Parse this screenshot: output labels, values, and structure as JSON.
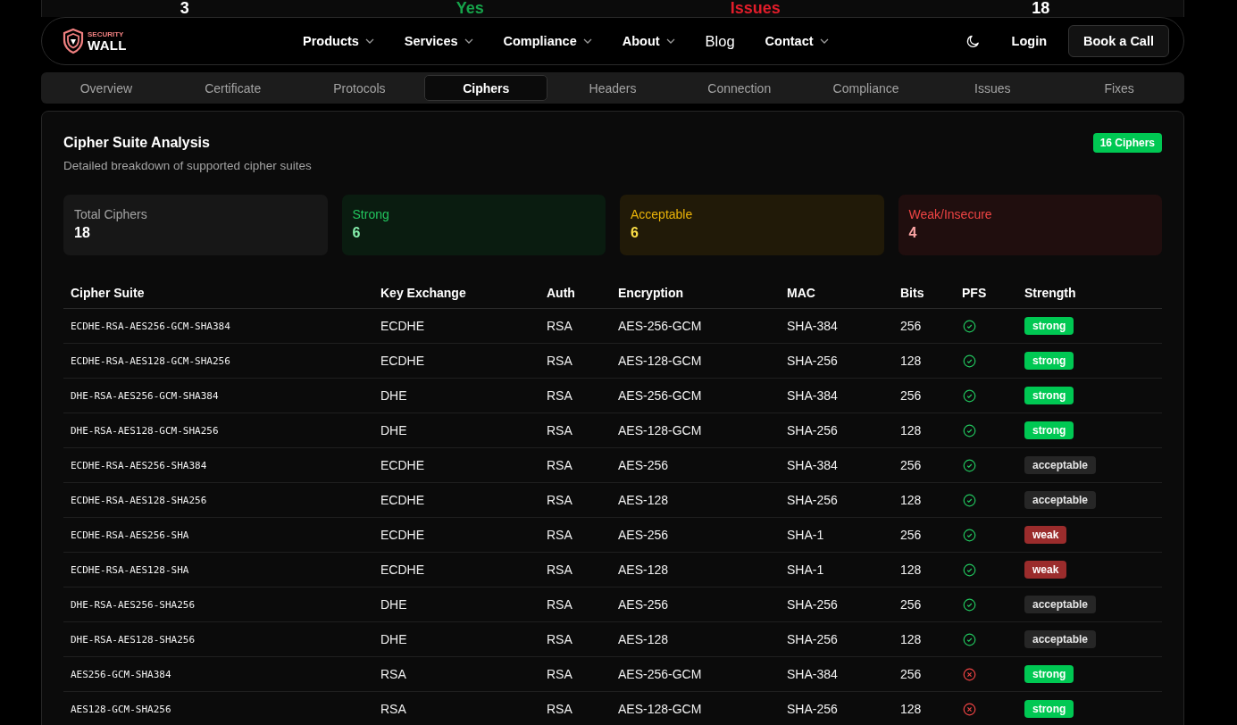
{
  "summary_strip": [
    "3",
    "Yes",
    "Issues",
    "18"
  ],
  "nav": {
    "logo_top": "SECURITY",
    "logo_bottom": "WALL",
    "links": [
      {
        "label": "Products",
        "dropdown": true
      },
      {
        "label": "Services",
        "dropdown": true
      },
      {
        "label": "Compliance",
        "dropdown": true
      },
      {
        "label": "About",
        "dropdown": true
      },
      {
        "label": "Blog",
        "dropdown": false
      },
      {
        "label": "Contact",
        "dropdown": true
      }
    ],
    "login": "Login",
    "cta": "Book a Call"
  },
  "tabs": [
    {
      "label": "Overview",
      "selected": false
    },
    {
      "label": "Certificate",
      "selected": false
    },
    {
      "label": "Protocols",
      "selected": false
    },
    {
      "label": "Ciphers",
      "selected": true
    },
    {
      "label": "Headers",
      "selected": false
    },
    {
      "label": "Connection",
      "selected": false
    },
    {
      "label": "Compliance",
      "selected": false
    },
    {
      "label": "Issues",
      "selected": false
    },
    {
      "label": "Fixes",
      "selected": false
    }
  ],
  "card": {
    "title": "Cipher Suite Analysis",
    "subtitle": "Detailed breakdown of supported cipher suites",
    "badge": "16 Ciphers",
    "stats": [
      {
        "kind": "neutral",
        "label": "Total Ciphers",
        "value": "18"
      },
      {
        "kind": "strong",
        "label": "Strong",
        "value": "6"
      },
      {
        "kind": "acceptable",
        "label": "Acceptable",
        "value": "6"
      },
      {
        "kind": "weak",
        "label": "Weak/Insecure",
        "value": "4"
      }
    ],
    "table": {
      "columns": [
        "Cipher Suite",
        "Key Exchange",
        "Auth",
        "Encryption",
        "MAC",
        "Bits",
        "PFS",
        "Strength"
      ],
      "rows": [
        {
          "suite": "ECDHE-RSA-AES256-GCM-SHA384",
          "kx": "ECDHE",
          "auth": "RSA",
          "enc": "AES-256-GCM",
          "mac": "SHA-384",
          "bits": "256",
          "pfs": true,
          "kind": "strong",
          "strength": "strong"
        },
        {
          "suite": "ECDHE-RSA-AES128-GCM-SHA256",
          "kx": "ECDHE",
          "auth": "RSA",
          "enc": "AES-128-GCM",
          "mac": "SHA-256",
          "bits": "128",
          "pfs": true,
          "kind": "strong",
          "strength": "strong"
        },
        {
          "suite": "DHE-RSA-AES256-GCM-SHA384",
          "kx": "DHE",
          "auth": "RSA",
          "enc": "AES-256-GCM",
          "mac": "SHA-384",
          "bits": "256",
          "pfs": true,
          "kind": "strong",
          "strength": "strong"
        },
        {
          "suite": "DHE-RSA-AES128-GCM-SHA256",
          "kx": "DHE",
          "auth": "RSA",
          "enc": "AES-128-GCM",
          "mac": "SHA-256",
          "bits": "128",
          "pfs": true,
          "kind": "strong",
          "strength": "strong"
        },
        {
          "suite": "ECDHE-RSA-AES256-SHA384",
          "kx": "ECDHE",
          "auth": "RSA",
          "enc": "AES-256",
          "mac": "SHA-384",
          "bits": "256",
          "pfs": true,
          "kind": "acceptable",
          "strength": "acceptable"
        },
        {
          "suite": "ECDHE-RSA-AES128-SHA256",
          "kx": "ECDHE",
          "auth": "RSA",
          "enc": "AES-128",
          "mac": "SHA-256",
          "bits": "128",
          "pfs": true,
          "kind": "acceptable",
          "strength": "acceptable"
        },
        {
          "suite": "ECDHE-RSA-AES256-SHA",
          "kx": "ECDHE",
          "auth": "RSA",
          "enc": "AES-256",
          "mac": "SHA-1",
          "bits": "256",
          "pfs": true,
          "kind": "weak",
          "strength": "weak"
        },
        {
          "suite": "ECDHE-RSA-AES128-SHA",
          "kx": "ECDHE",
          "auth": "RSA",
          "enc": "AES-128",
          "mac": "SHA-1",
          "bits": "128",
          "pfs": true,
          "kind": "weak",
          "strength": "weak"
        },
        {
          "suite": "DHE-RSA-AES256-SHA256",
          "kx": "DHE",
          "auth": "RSA",
          "enc": "AES-256",
          "mac": "SHA-256",
          "bits": "256",
          "pfs": true,
          "kind": "acceptable",
          "strength": "acceptable"
        },
        {
          "suite": "DHE-RSA-AES128-SHA256",
          "kx": "DHE",
          "auth": "RSA",
          "enc": "AES-128",
          "mac": "SHA-256",
          "bits": "128",
          "pfs": true,
          "kind": "acceptable",
          "strength": "acceptable"
        },
        {
          "suite": "AES256-GCM-SHA384",
          "kx": "RSA",
          "auth": "RSA",
          "enc": "AES-256-GCM",
          "mac": "SHA-384",
          "bits": "256",
          "pfs": false,
          "kind": "strong",
          "strength": "strong"
        },
        {
          "suite": "AES128-GCM-SHA256",
          "kx": "RSA",
          "auth": "RSA",
          "enc": "AES-128-GCM",
          "mac": "SHA-256",
          "bits": "128",
          "pfs": false,
          "kind": "strong",
          "strength": "strong"
        }
      ]
    }
  }
}
